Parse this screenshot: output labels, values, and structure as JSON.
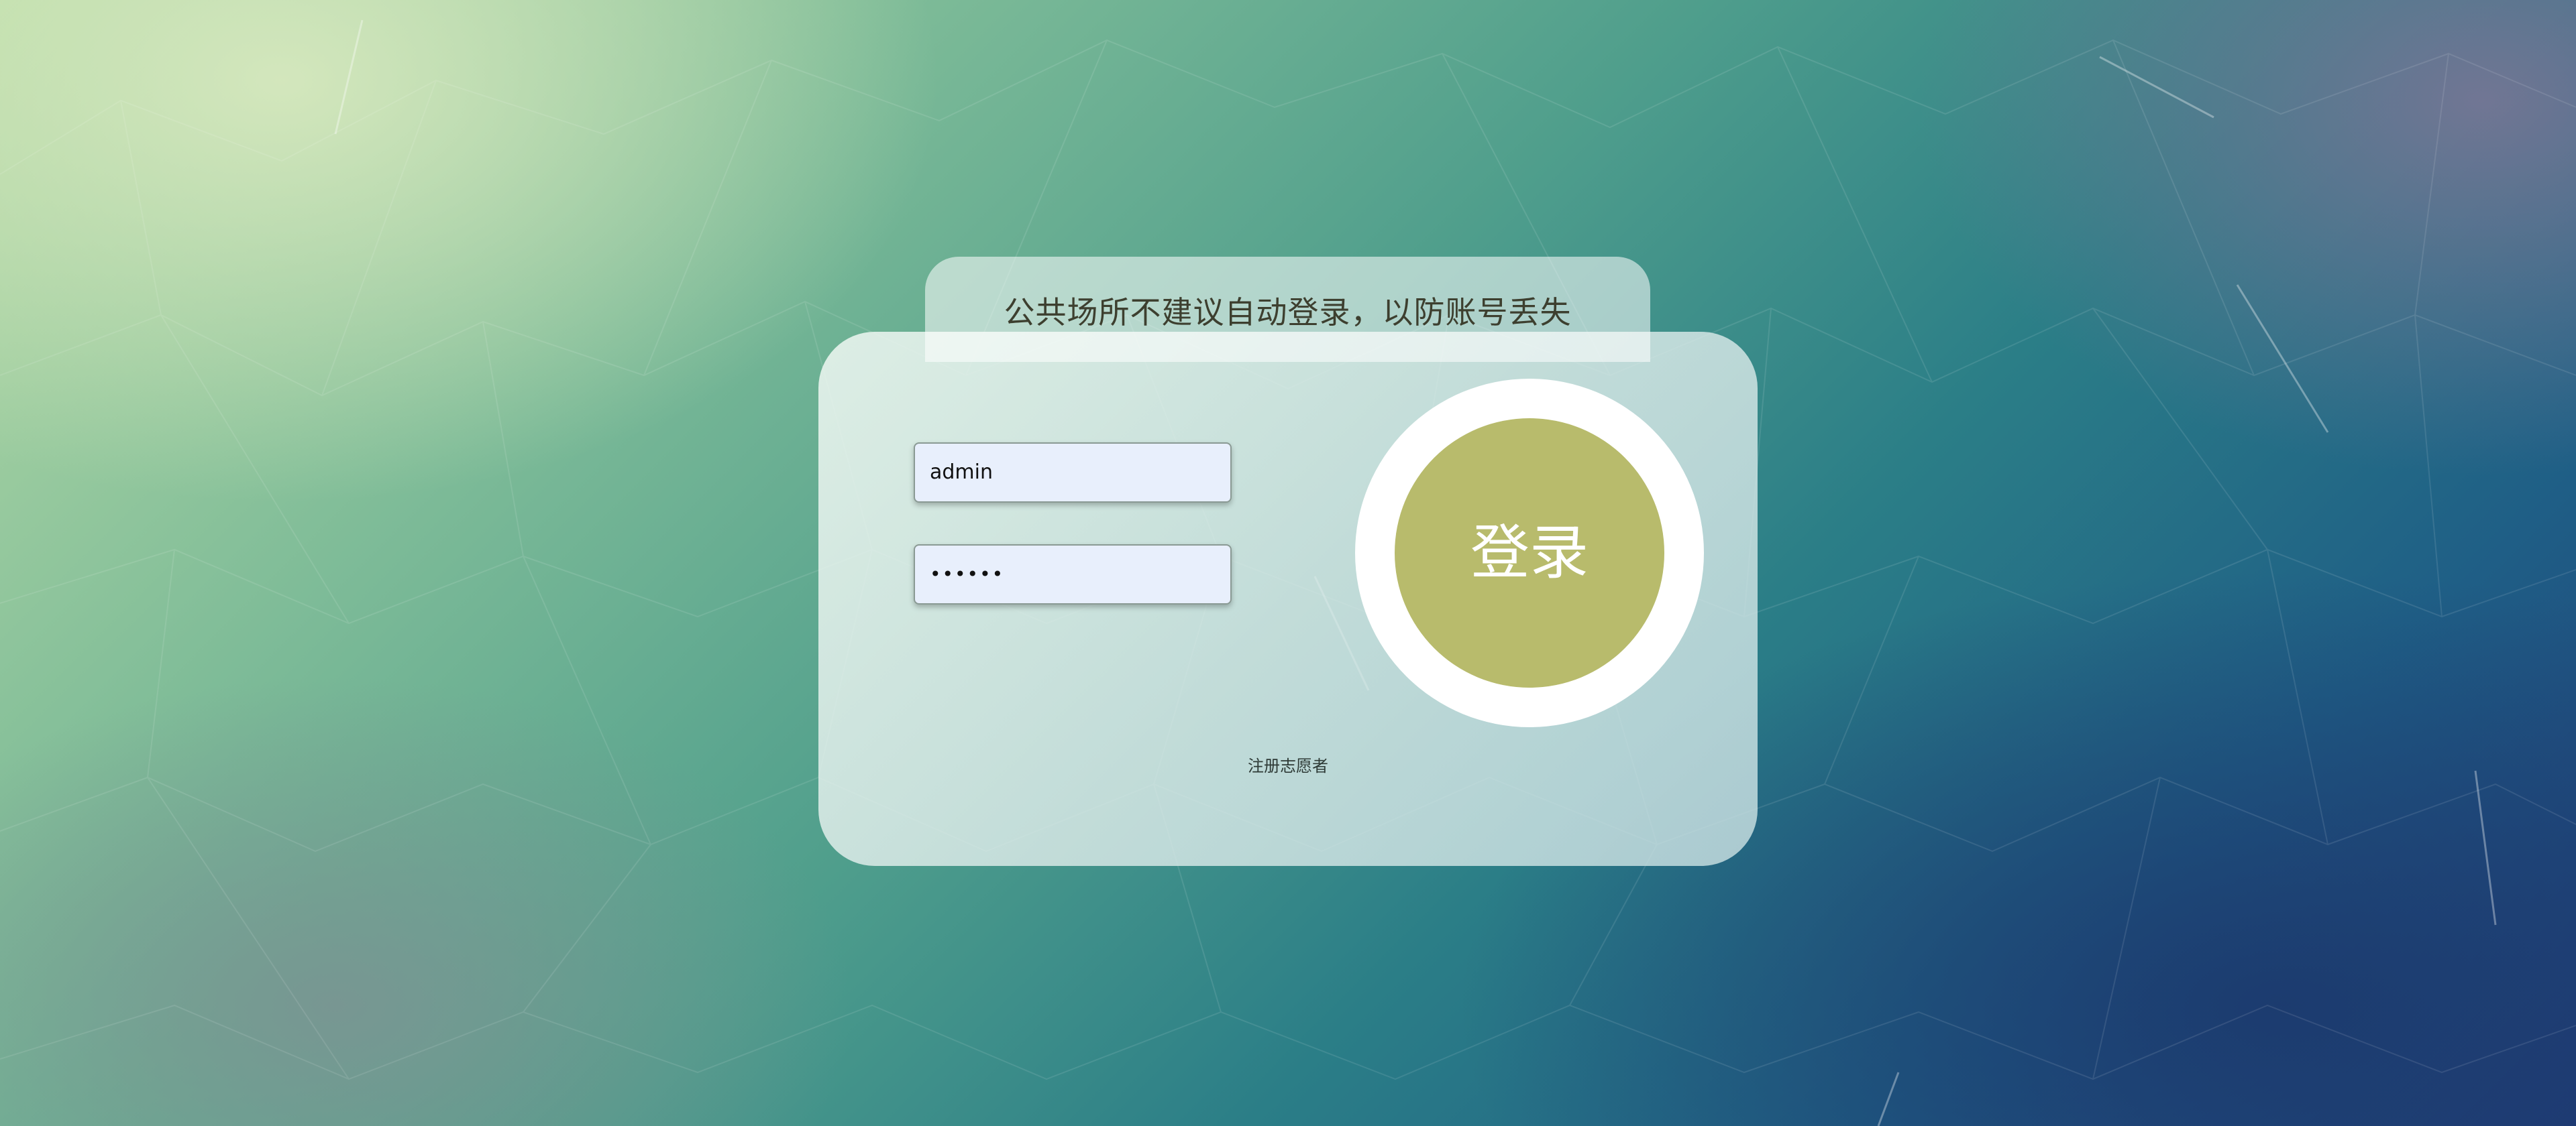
{
  "notice": {
    "text": "公共场所不建议自动登录，以防账号丢失"
  },
  "form": {
    "username_value": "admin",
    "password_value": "••••••",
    "login_label": "登录",
    "register_label": "注册志愿者"
  },
  "colors": {
    "login_button": "#b8bb6c",
    "login_ring": "#ffffff",
    "input_background": "#e8effc"
  }
}
